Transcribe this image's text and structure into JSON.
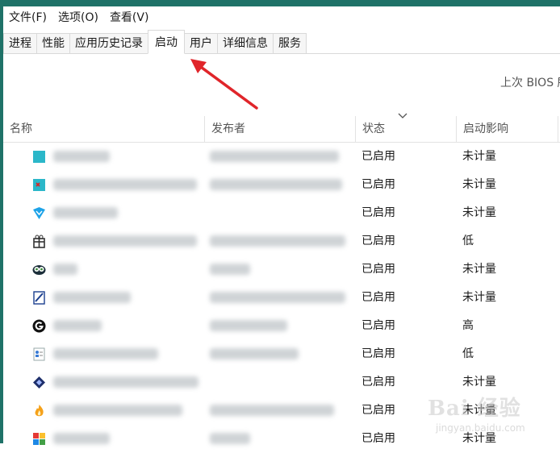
{
  "menu": [
    "文件(F)",
    "选项(O)",
    "查看(V)"
  ],
  "tabs": [
    {
      "label": "进程",
      "active": false
    },
    {
      "label": "性能",
      "active": false
    },
    {
      "label": "应用历史记录",
      "active": false
    },
    {
      "label": "启动",
      "active": true
    },
    {
      "label": "用户",
      "active": false
    },
    {
      "label": "详细信息",
      "active": false
    },
    {
      "label": "服务",
      "active": false
    }
  ],
  "bios_text": "上次 BIOS 所",
  "columns": {
    "name": "名称",
    "publisher": "发布者",
    "status": "状态",
    "impact": "启动影响"
  },
  "rows": [
    {
      "icon": "teal-square-icon",
      "status": "已启用",
      "impact": "未计量"
    },
    {
      "icon": "teal-x-icon",
      "status": "已启用",
      "impact": "未计量"
    },
    {
      "icon": "blue-shield-icon",
      "status": "已启用",
      "impact": "未计量"
    },
    {
      "icon": "gift-box-icon",
      "status": "已启用",
      "impact": "低"
    },
    {
      "icon": "owl-icon",
      "status": "已启用",
      "impact": "未计量"
    },
    {
      "icon": "pen-document-icon",
      "status": "已启用",
      "impact": "未计量"
    },
    {
      "icon": "logitech-g-icon",
      "status": "已启用",
      "impact": "高"
    },
    {
      "icon": "contact-card-icon",
      "status": "已启用",
      "impact": "低"
    },
    {
      "icon": "diamond-app-icon",
      "status": "已启用",
      "impact": "未计量"
    },
    {
      "icon": "flame-icon",
      "status": "已启用",
      "impact": "未计量"
    },
    {
      "icon": "colorful-grid-icon",
      "status": "已启用",
      "impact": "未计量"
    }
  ],
  "watermark": {
    "main": "Bai 经验",
    "sub": "jingyan.baidu.com"
  },
  "colors": {
    "titlebar": "#1f7268",
    "arrow": "#e0252a"
  }
}
